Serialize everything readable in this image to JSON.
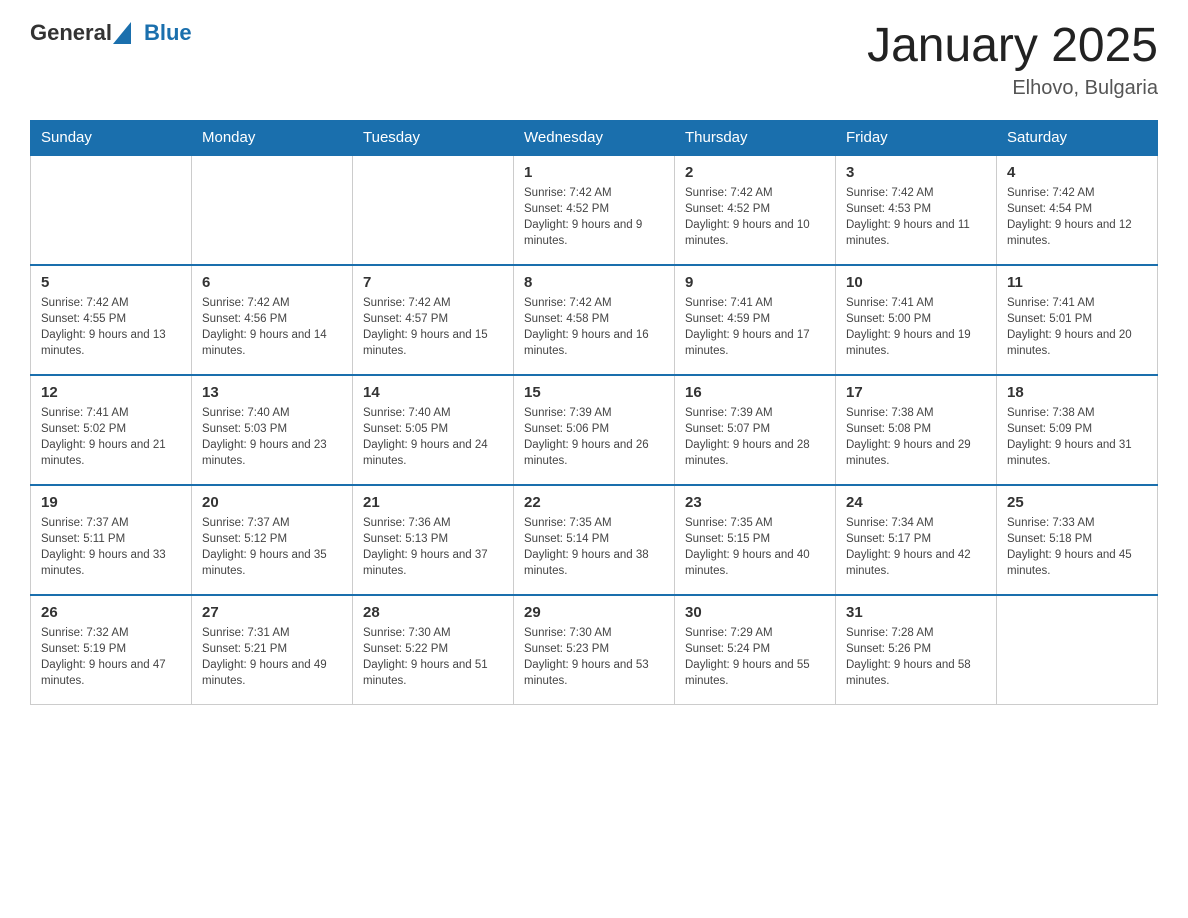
{
  "logo": {
    "general": "General",
    "blue": "Blue"
  },
  "title": "January 2025",
  "subtitle": "Elhovo, Bulgaria",
  "days_of_week": [
    "Sunday",
    "Monday",
    "Tuesday",
    "Wednesday",
    "Thursday",
    "Friday",
    "Saturday"
  ],
  "weeks": [
    [
      {
        "day": "",
        "info": ""
      },
      {
        "day": "",
        "info": ""
      },
      {
        "day": "",
        "info": ""
      },
      {
        "day": "1",
        "info": "Sunrise: 7:42 AM\nSunset: 4:52 PM\nDaylight: 9 hours and 9 minutes."
      },
      {
        "day": "2",
        "info": "Sunrise: 7:42 AM\nSunset: 4:52 PM\nDaylight: 9 hours and 10 minutes."
      },
      {
        "day": "3",
        "info": "Sunrise: 7:42 AM\nSunset: 4:53 PM\nDaylight: 9 hours and 11 minutes."
      },
      {
        "day": "4",
        "info": "Sunrise: 7:42 AM\nSunset: 4:54 PM\nDaylight: 9 hours and 12 minutes."
      }
    ],
    [
      {
        "day": "5",
        "info": "Sunrise: 7:42 AM\nSunset: 4:55 PM\nDaylight: 9 hours and 13 minutes."
      },
      {
        "day": "6",
        "info": "Sunrise: 7:42 AM\nSunset: 4:56 PM\nDaylight: 9 hours and 14 minutes."
      },
      {
        "day": "7",
        "info": "Sunrise: 7:42 AM\nSunset: 4:57 PM\nDaylight: 9 hours and 15 minutes."
      },
      {
        "day": "8",
        "info": "Sunrise: 7:42 AM\nSunset: 4:58 PM\nDaylight: 9 hours and 16 minutes."
      },
      {
        "day": "9",
        "info": "Sunrise: 7:41 AM\nSunset: 4:59 PM\nDaylight: 9 hours and 17 minutes."
      },
      {
        "day": "10",
        "info": "Sunrise: 7:41 AM\nSunset: 5:00 PM\nDaylight: 9 hours and 19 minutes."
      },
      {
        "day": "11",
        "info": "Sunrise: 7:41 AM\nSunset: 5:01 PM\nDaylight: 9 hours and 20 minutes."
      }
    ],
    [
      {
        "day": "12",
        "info": "Sunrise: 7:41 AM\nSunset: 5:02 PM\nDaylight: 9 hours and 21 minutes."
      },
      {
        "day": "13",
        "info": "Sunrise: 7:40 AM\nSunset: 5:03 PM\nDaylight: 9 hours and 23 minutes."
      },
      {
        "day": "14",
        "info": "Sunrise: 7:40 AM\nSunset: 5:05 PM\nDaylight: 9 hours and 24 minutes."
      },
      {
        "day": "15",
        "info": "Sunrise: 7:39 AM\nSunset: 5:06 PM\nDaylight: 9 hours and 26 minutes."
      },
      {
        "day": "16",
        "info": "Sunrise: 7:39 AM\nSunset: 5:07 PM\nDaylight: 9 hours and 28 minutes."
      },
      {
        "day": "17",
        "info": "Sunrise: 7:38 AM\nSunset: 5:08 PM\nDaylight: 9 hours and 29 minutes."
      },
      {
        "day": "18",
        "info": "Sunrise: 7:38 AM\nSunset: 5:09 PM\nDaylight: 9 hours and 31 minutes."
      }
    ],
    [
      {
        "day": "19",
        "info": "Sunrise: 7:37 AM\nSunset: 5:11 PM\nDaylight: 9 hours and 33 minutes."
      },
      {
        "day": "20",
        "info": "Sunrise: 7:37 AM\nSunset: 5:12 PM\nDaylight: 9 hours and 35 minutes."
      },
      {
        "day": "21",
        "info": "Sunrise: 7:36 AM\nSunset: 5:13 PM\nDaylight: 9 hours and 37 minutes."
      },
      {
        "day": "22",
        "info": "Sunrise: 7:35 AM\nSunset: 5:14 PM\nDaylight: 9 hours and 38 minutes."
      },
      {
        "day": "23",
        "info": "Sunrise: 7:35 AM\nSunset: 5:15 PM\nDaylight: 9 hours and 40 minutes."
      },
      {
        "day": "24",
        "info": "Sunrise: 7:34 AM\nSunset: 5:17 PM\nDaylight: 9 hours and 42 minutes."
      },
      {
        "day": "25",
        "info": "Sunrise: 7:33 AM\nSunset: 5:18 PM\nDaylight: 9 hours and 45 minutes."
      }
    ],
    [
      {
        "day": "26",
        "info": "Sunrise: 7:32 AM\nSunset: 5:19 PM\nDaylight: 9 hours and 47 minutes."
      },
      {
        "day": "27",
        "info": "Sunrise: 7:31 AM\nSunset: 5:21 PM\nDaylight: 9 hours and 49 minutes."
      },
      {
        "day": "28",
        "info": "Sunrise: 7:30 AM\nSunset: 5:22 PM\nDaylight: 9 hours and 51 minutes."
      },
      {
        "day": "29",
        "info": "Sunrise: 7:30 AM\nSunset: 5:23 PM\nDaylight: 9 hours and 53 minutes."
      },
      {
        "day": "30",
        "info": "Sunrise: 7:29 AM\nSunset: 5:24 PM\nDaylight: 9 hours and 55 minutes."
      },
      {
        "day": "31",
        "info": "Sunrise: 7:28 AM\nSunset: 5:26 PM\nDaylight: 9 hours and 58 minutes."
      },
      {
        "day": "",
        "info": ""
      }
    ]
  ]
}
